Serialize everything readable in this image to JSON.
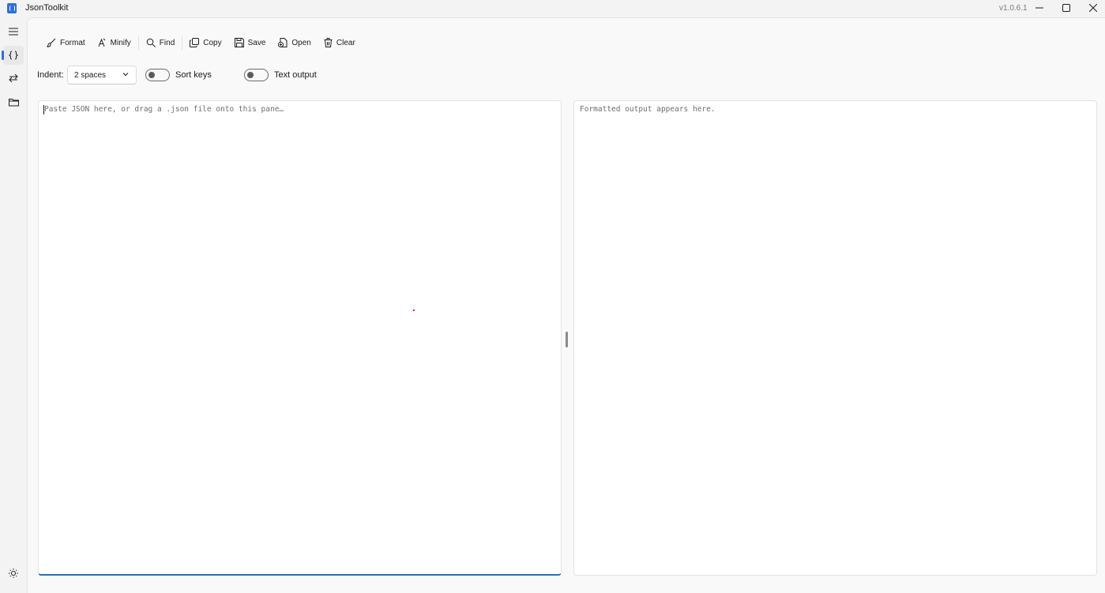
{
  "window": {
    "title": "JsonToolkit",
    "version": "v1.0.6.1"
  },
  "sidebar": {
    "items": [
      {
        "icon": "hamburger-menu-icon"
      },
      {
        "icon": "braces-icon",
        "active": true
      },
      {
        "icon": "swap-arrows-icon"
      },
      {
        "icon": "folder-icon"
      }
    ],
    "footer_icon": "theme-sun-icon"
  },
  "toolbar": {
    "format_label": "Format",
    "minify_label": "Minify",
    "find_label": "Find",
    "copy_label": "Copy",
    "save_label": "Save",
    "open_label": "Open",
    "clear_label": "Clear"
  },
  "options": {
    "indent_label": "Indent:",
    "indent_value": "2 spaces",
    "sort_keys_label": "Sort keys",
    "sort_keys_on": false,
    "text_output_label": "Text output",
    "text_output_on": false
  },
  "editor": {
    "input_placeholder": "Paste JSON here, or drag a .json file onto this pane…",
    "output_placeholder": "Formatted output appears here."
  },
  "colors": {
    "accent": "#2a6fbd",
    "background": "#f3f3f3",
    "content": "#f9f9f9",
    "pane": "#ffffff"
  }
}
